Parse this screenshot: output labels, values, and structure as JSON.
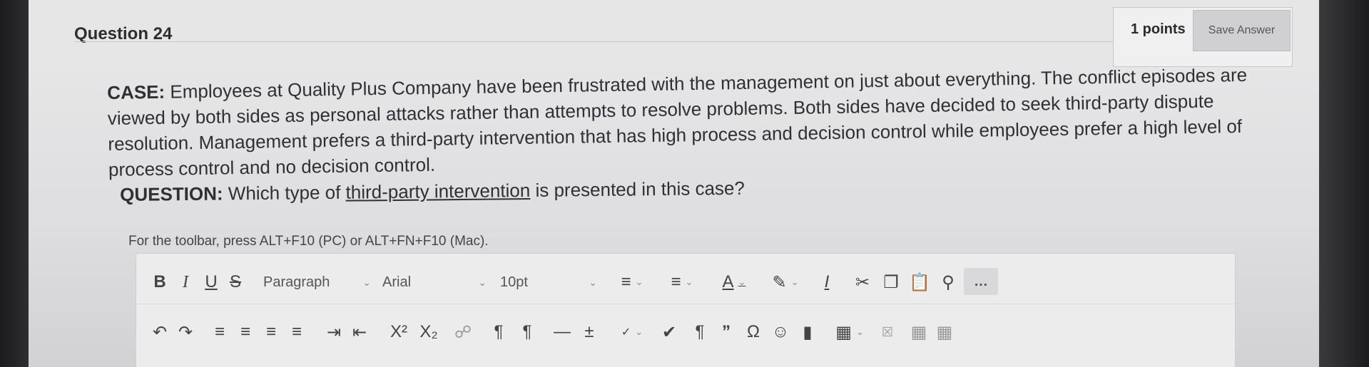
{
  "question": {
    "title": "Question 24",
    "points": "1 points",
    "save_label": "Save Answer"
  },
  "case": {
    "label": "CASE:",
    "text": "Employees at Quality Plus Company have been frustrated with the management on just about everything. The conflict episodes are viewed by both sides as personal attacks rather than attempts to resolve problems. Both sides have decided to seek third-party dispute resolution. Management prefers a third-party intervention that has high process and decision control while employees prefer a high level of process control and no decision control."
  },
  "prompt": {
    "label": "QUESTION:",
    "text_before": "Which type of",
    "underlined": "third-party intervention",
    "text_after": "is presented in this case?"
  },
  "editor": {
    "hint": "For the toolbar, press ALT+F10 (PC) or ALT+FN+F10 (Mac).",
    "block_format": "Paragraph",
    "font_family": "Arial",
    "font_size": "10pt",
    "icons": [
      "bold-icon",
      "italic-icon",
      "underline-icon",
      "strikethrough-icon",
      "bullet-list-icon",
      "numbered-list-icon",
      "text-color-icon",
      "highlight-icon",
      "clear-format-icon",
      "cut-icon",
      "copy-icon",
      "paste-icon",
      "search-icon",
      "more-icon",
      "undo-icon",
      "redo-icon",
      "align-left-icon",
      "align-center-icon",
      "align-right-icon",
      "justify-icon",
      "indent-icon",
      "outdent-icon",
      "superscript-icon",
      "subscript-icon",
      "unlink-icon",
      "ltr-icon",
      "rtl-icon",
      "horizontal-rule-icon",
      "insert-icon",
      "spellcheck-icon",
      "checkmark-icon",
      "pilcrow-icon",
      "quote-icon",
      "omega-icon",
      "emoji-icon",
      "bookmark-icon",
      "table-icon",
      "delete-table-icon",
      "table-props-icon",
      "table-cells-icon"
    ]
  }
}
